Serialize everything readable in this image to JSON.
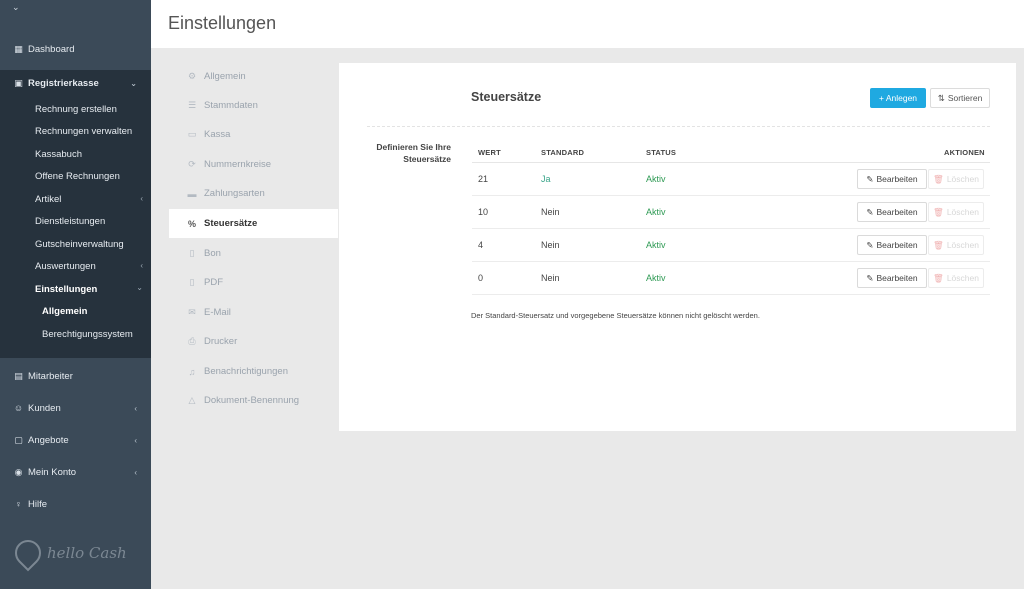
{
  "sidebar": {
    "collapse_glyph": "⌄",
    "top_items": [
      {
        "label": "Dashboard",
        "icon": "grid-icon"
      },
      {
        "label": "Registrierkasse",
        "icon": "cash-register-icon"
      }
    ],
    "sub_items": [
      {
        "label": "Rechnung erstellen"
      },
      {
        "label": "Rechnungen verwalten"
      },
      {
        "label": "Kassabuch"
      },
      {
        "label": "Offene Rechnungen"
      },
      {
        "label": "Artikel"
      },
      {
        "label": "Dienstleistungen"
      },
      {
        "label": "Gutscheinverwaltung"
      },
      {
        "label": "Auswertungen"
      },
      {
        "label": "Einstellungen"
      },
      {
        "label": "Allgemein"
      },
      {
        "label": "Berechtigungssystem"
      }
    ],
    "bottom_items": [
      {
        "label": "Mitarbeiter",
        "icon": "employees-icon"
      },
      {
        "label": "Kunden",
        "icon": "customers-icon"
      },
      {
        "label": "Angebote",
        "icon": "briefcase-icon"
      },
      {
        "label": "Mein Konto",
        "icon": "account-icon"
      },
      {
        "label": "Hilfe",
        "icon": "help-icon"
      }
    ],
    "logo_text": "hello Cash"
  },
  "header": {
    "title": "Einstellungen"
  },
  "settings_menu": [
    {
      "label": "Allgemein",
      "icon": "gear-icon"
    },
    {
      "label": "Stammdaten",
      "icon": "database-icon"
    },
    {
      "label": "Kassa",
      "icon": "monitor-icon"
    },
    {
      "label": "Nummernkreise",
      "icon": "refresh-icon"
    },
    {
      "label": "Zahlungsarten",
      "icon": "credit-card-icon"
    },
    {
      "label": "Steuersätze",
      "icon": "percent-icon"
    },
    {
      "label": "Bon",
      "icon": "file-icon"
    },
    {
      "label": "PDF",
      "icon": "pdf-icon"
    },
    {
      "label": "E-Mail",
      "icon": "envelope-icon"
    },
    {
      "label": "Drucker",
      "icon": "printer-icon"
    },
    {
      "label": "Benachrichtigungen",
      "icon": "bell-icon"
    },
    {
      "label": "Dokument-Benennung",
      "icon": "warning-icon"
    }
  ],
  "content": {
    "title": "Steuersätze",
    "add_button": "+ Anlegen",
    "sort_button": "Sortieren",
    "description": "Definieren Sie Ihre Steuersätze",
    "columns": {
      "wert": "WERT",
      "standard": "STANDARD",
      "status": "STATUS",
      "aktionen": "AKTIONEN"
    },
    "rows": [
      {
        "wert": "21",
        "standard": "Ja",
        "status": "Aktiv",
        "edit": "Bearbeiten",
        "delete": "Löschen"
      },
      {
        "wert": "10",
        "standard": "Nein",
        "status": "Aktiv",
        "edit": "Bearbeiten",
        "delete": "Löschen"
      },
      {
        "wert": "4",
        "standard": "Nein",
        "status": "Aktiv",
        "edit": "Bearbeiten",
        "delete": "Löschen"
      },
      {
        "wert": "0",
        "standard": "Nein",
        "status": "Aktiv",
        "edit": "Bearbeiten",
        "delete": "Löschen"
      }
    ],
    "footnote": "Der Standard-Steuersatz und vorgegebene Steuersätze können nicht gelöscht werden."
  },
  "colors": {
    "sidebar_bg": "#3b4a58",
    "sidebar_active_bg": "#26323d",
    "accent": "#1fa9e1",
    "status_green": "#2e9a54",
    "delete_red": "#f0b3b3"
  }
}
